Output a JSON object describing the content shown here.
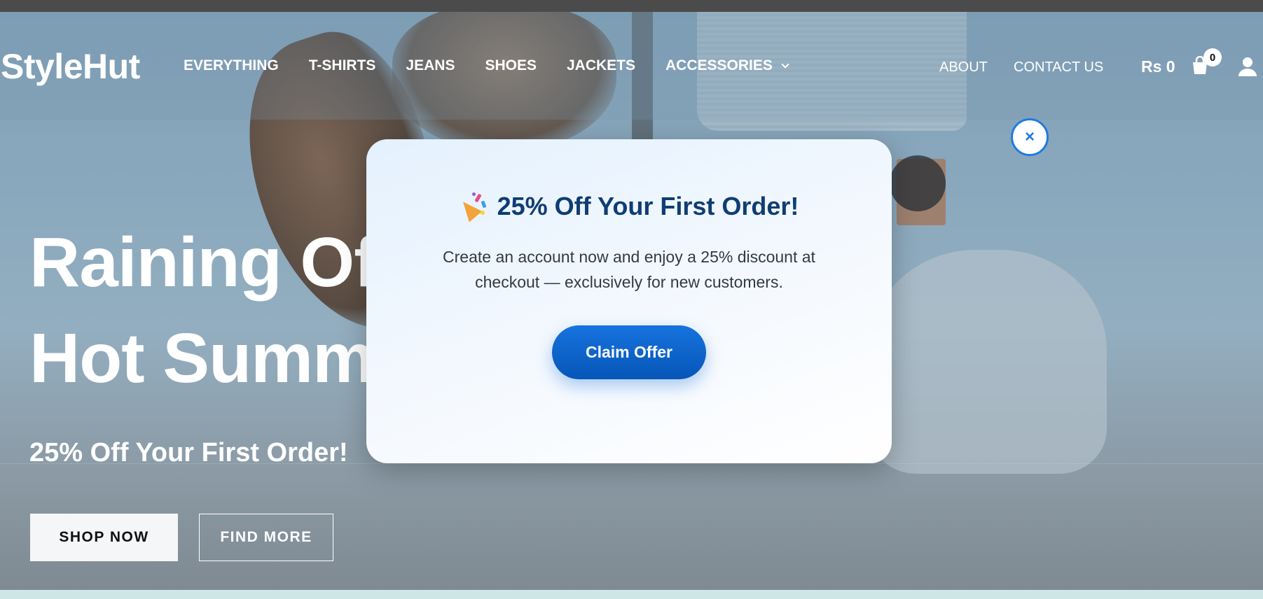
{
  "header": {
    "logo": "StyleHut",
    "nav": [
      "EVERYTHING",
      "T-SHIRTS",
      "JEANS",
      "SHOES",
      "JACKETS",
      "ACCESSORIES"
    ],
    "about": "ABOUT",
    "contact": "CONTACT US",
    "cart_total": "Rs 0",
    "cart_count": "0"
  },
  "hero": {
    "line1": "Raining Offers For",
    "line2": "Hot Summer!",
    "subtitle": "25% Off Your First Order!",
    "shop_now": "SHOP NOW",
    "find_more": "FIND MORE"
  },
  "popup": {
    "title": "25% Off Your First Order!",
    "body": "Create an account now and enjoy a 25% discount at checkout — exclusively for new customers.",
    "cta": "Claim Offer",
    "close": "×"
  },
  "icons": {
    "party": "party-popper-icon",
    "cart": "shopping-bag-icon",
    "user": "user-icon",
    "close": "close-icon",
    "dropdown": "chevron-down-icon"
  },
  "colors": {
    "popup_title": "#0f3d73",
    "cta": "#0b66d0",
    "close_border": "#1e7be0"
  }
}
